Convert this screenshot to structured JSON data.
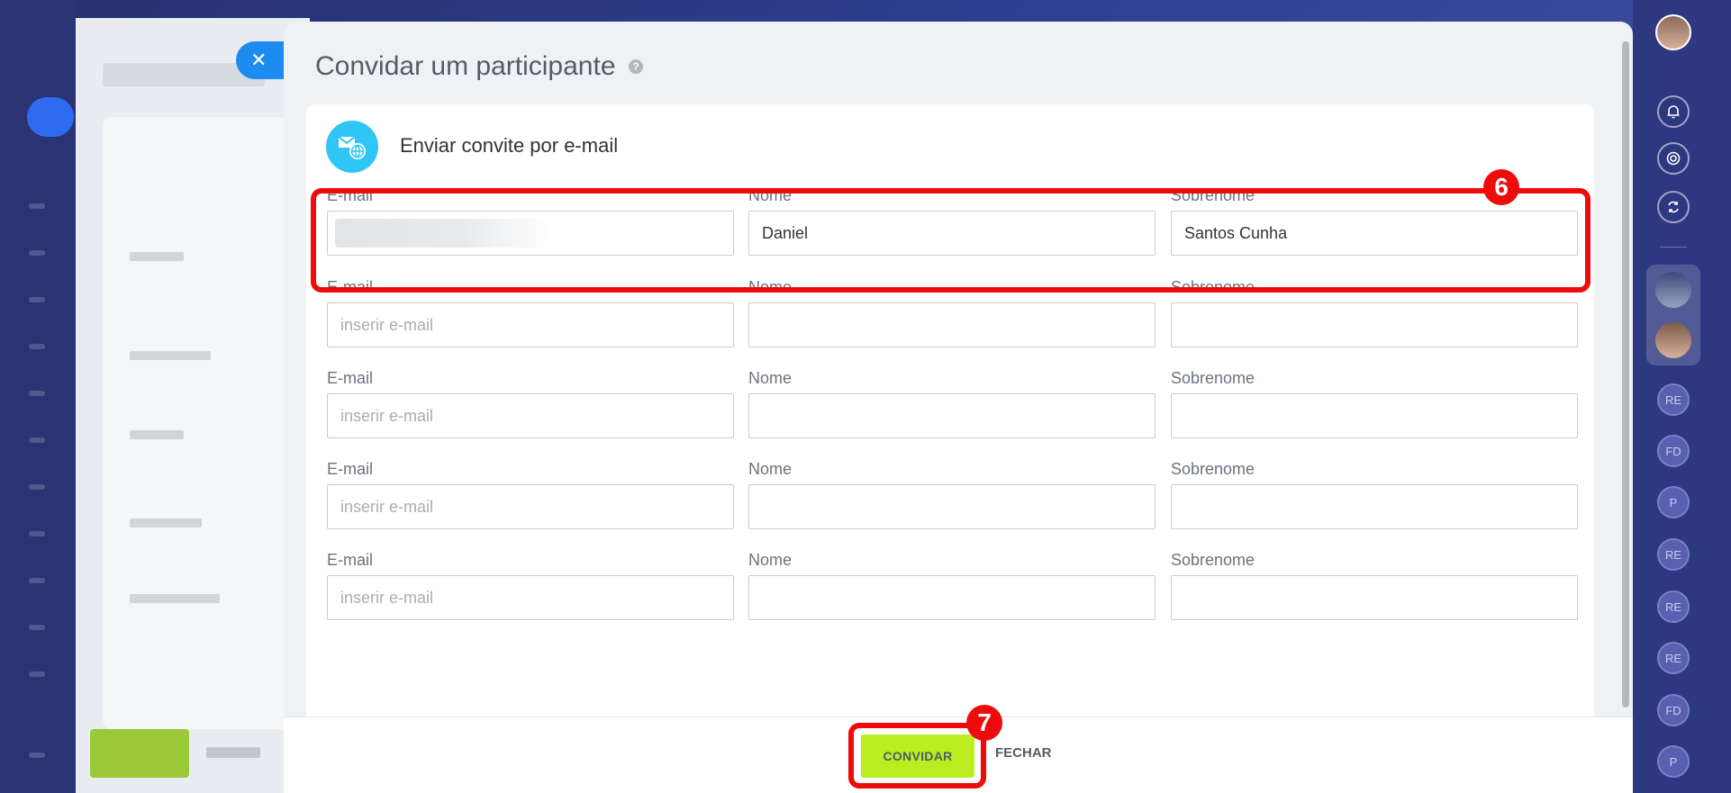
{
  "modal": {
    "title": "Convidar um participante",
    "help_glyph": "?",
    "close_glyph": "✕"
  },
  "card": {
    "title": "Enviar convite por e-mail"
  },
  "form": {
    "email_label": "E-mail",
    "name_label": "Nome",
    "surname_label": "Sobrenome",
    "email_placeholder": "inserir e-mail",
    "rows": [
      {
        "email": "",
        "name": "Daniel",
        "surname": "Santos Cunha"
      },
      {
        "email": "",
        "name": "",
        "surname": ""
      },
      {
        "email": "",
        "name": "",
        "surname": ""
      },
      {
        "email": "",
        "name": "",
        "surname": ""
      },
      {
        "email": "",
        "name": "",
        "surname": ""
      }
    ]
  },
  "footer": {
    "invite_label": "CONVIDAR",
    "close_label": "FECHAR"
  },
  "annotations": {
    "step_fields": "6",
    "step_invite": "7"
  },
  "right_sidebar": {
    "initials": [
      "RE",
      "FD",
      "P",
      "RE",
      "RE",
      "RE",
      "FD",
      "P"
    ]
  },
  "colors": {
    "accent_blue": "#1d8cf0",
    "invite_green": "#bbed21",
    "annotation_red": "#ee0b0b"
  }
}
